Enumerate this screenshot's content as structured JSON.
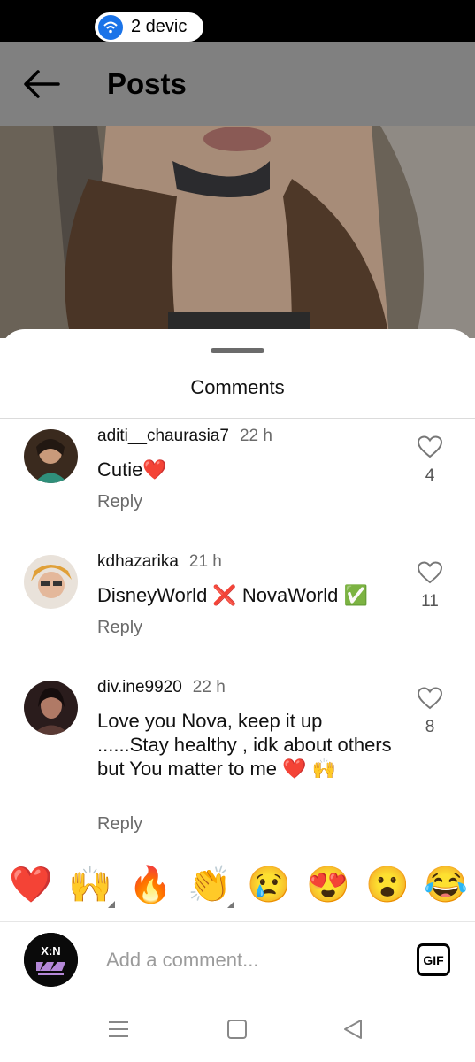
{
  "status_bar": {
    "devices_label": "2 devic"
  },
  "header": {
    "title": "Posts"
  },
  "sheet": {
    "title": "Comments"
  },
  "comments": [
    {
      "username": "aditi__chaurasia7",
      "time": "22 h",
      "text": "Cutie❤️",
      "reply_label": "Reply",
      "likes": "4"
    },
    {
      "username": "kdhazarika",
      "time": "21 h",
      "text": "DisneyWorld ❌ NovaWorld ✅",
      "reply_label": "Reply",
      "likes": "11"
    },
    {
      "username": "div.ine9920",
      "time": "22 h",
      "text": "Love you Nova, keep it up ......Stay healthy , idk about others but You matter to me ❤️ 🙌",
      "reply_label": "Reply",
      "likes": "8"
    }
  ],
  "reactions": [
    "❤️",
    "🙌",
    "🔥",
    "👏",
    "😢",
    "😍",
    "😮",
    "😂"
  ],
  "composer": {
    "placeholder": "Add a comment...",
    "gif_label": "GIF",
    "avatar_text": "X:N"
  },
  "icons": {
    "back": "arrow-left-icon",
    "like": "heart-outline-icon",
    "wifi": "wifi-icon",
    "nav_recents": "menu-icon",
    "nav_home": "square-icon",
    "nav_back": "triangle-back-icon"
  },
  "colors": {
    "accent": "#1a73e8",
    "heart": "#e0243c",
    "muted": "#6b6b6b"
  }
}
